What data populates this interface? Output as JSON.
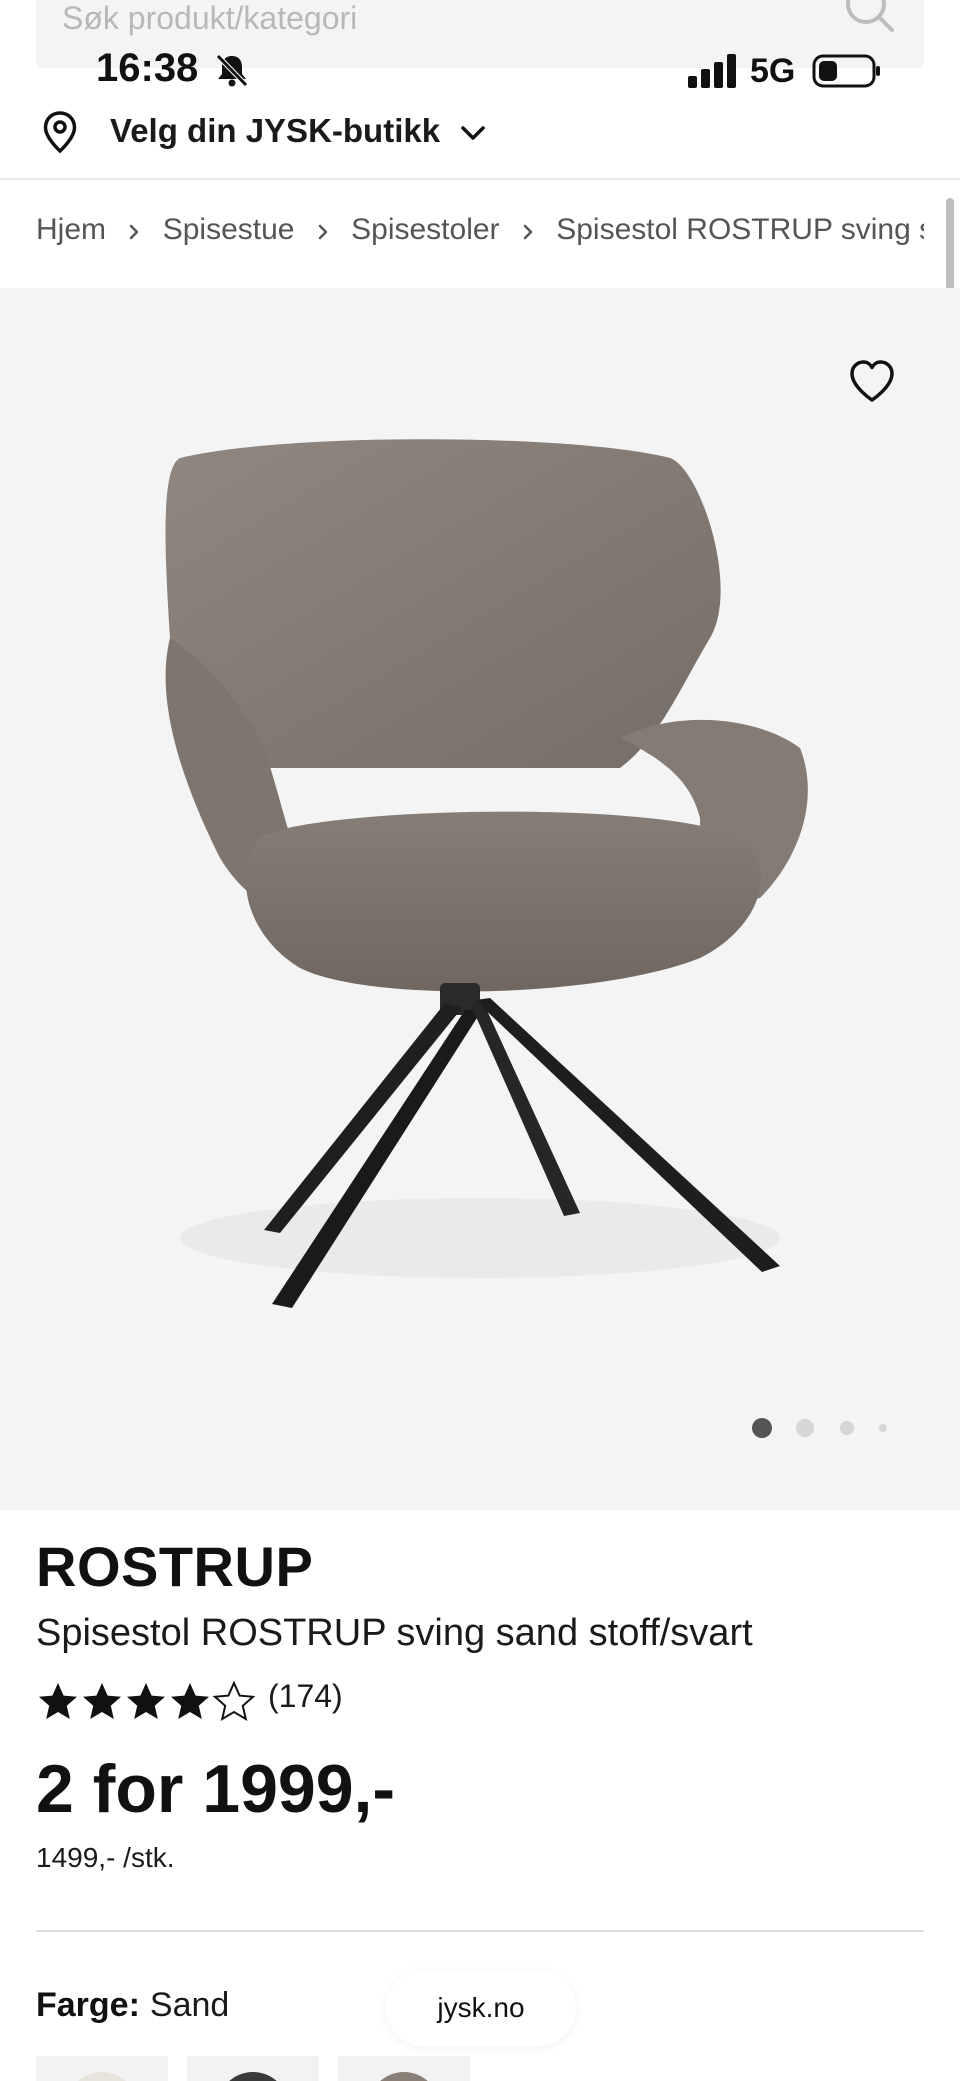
{
  "search": {
    "placeholder": "Søk produkt/kategori"
  },
  "status_bar": {
    "time": "16:38",
    "network": "5G"
  },
  "store": {
    "label": "Velg din JYSK-butikk"
  },
  "breadcrumb": [
    {
      "label": "Hjem"
    },
    {
      "label": "Spisestue"
    },
    {
      "label": "Spisestoler"
    },
    {
      "label": "Spisestol ROSTRUP sving sa"
    }
  ],
  "gallery": {
    "image_count": 4,
    "active_index": 0
  },
  "product": {
    "brand": "ROSTRUP",
    "name": "Spisestol ROSTRUP sving sand stoff/svart",
    "rating": 4.5,
    "review_count": "(174)",
    "price": "2 for 1999,-",
    "unit_price": "1499,- /stk."
  },
  "color": {
    "label": "Farge:",
    "value": "Sand"
  },
  "browser": {
    "domain": "jysk.no"
  },
  "swatches": [
    {
      "color": "#e8e3dc"
    },
    {
      "color": "#3a3a3a"
    },
    {
      "color": "#8a8078"
    }
  ],
  "colors": {
    "accent": "#111111",
    "hero_bg": "#f4f4f4",
    "divider": "#e6e6e6"
  }
}
